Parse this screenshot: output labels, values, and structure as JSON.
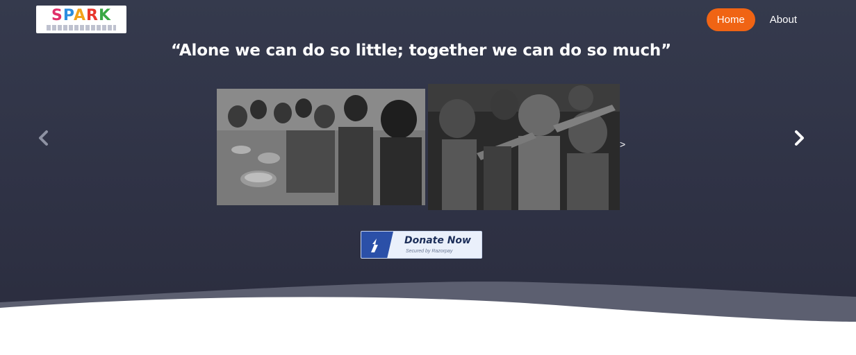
{
  "brand": {
    "logo_text": [
      "S",
      "P",
      "A",
      "R",
      "K"
    ],
    "icon": "spark-logo"
  },
  "nav": {
    "items": [
      {
        "label": "Home",
        "active": true
      },
      {
        "label": "About",
        "active": false
      }
    ],
    "accent_color": "#f06414"
  },
  "hero": {
    "quote": "“Alone we can do so little; together we can do so much”",
    "background_color": "#2f3245"
  },
  "carousel": {
    "prev_icon": "chevron-left-icon",
    "next_icon": "chevron-right-icon",
    "inline_next_glyph": ">",
    "slides": [
      {
        "name": "children-with-bowls-photo"
      },
      {
        "name": "children-reaching-photo"
      }
    ]
  },
  "donate": {
    "title": "Donate Now",
    "subtitle": "Secured by Razorpay",
    "icon": "razorpay-icon",
    "badge_color": "#2b50a8"
  }
}
